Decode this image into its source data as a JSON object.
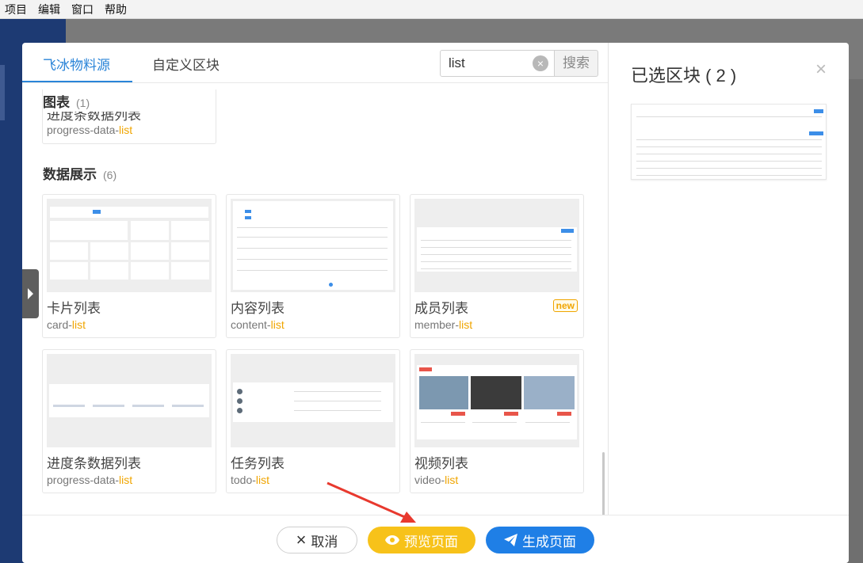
{
  "menubar": {
    "items": [
      "项目",
      "编辑",
      "窗口",
      "帮助"
    ]
  },
  "modal": {
    "tabs": [
      {
        "label": "飞冰物料源"
      },
      {
        "label": "自定义区块"
      }
    ],
    "search": {
      "value": "list",
      "clear_icon": "×",
      "button_label": "搜索"
    },
    "sections": [
      {
        "title": "图表",
        "count": "(1)"
      },
      {
        "title": "数据展示",
        "count": "(6)"
      }
    ],
    "partial_card": {
      "name": "进度条数据列表",
      "slug_prefix": "progress-data-",
      "slug_highlight": "list"
    },
    "cards": [
      {
        "name": "卡片列表",
        "slug_prefix": "card-",
        "slug_highlight": "list"
      },
      {
        "name": "内容列表",
        "slug_prefix": "content-",
        "slug_highlight": "list"
      },
      {
        "name": "成员列表",
        "slug_prefix": "member-",
        "slug_highlight": "list",
        "badge": "new"
      },
      {
        "name": "进度条数据列表",
        "slug_prefix": "progress-data-",
        "slug_highlight": "list"
      },
      {
        "name": "任务列表",
        "slug_prefix": "todo-",
        "slug_highlight": "list"
      },
      {
        "name": "视频列表",
        "slug_prefix": "video-",
        "slug_highlight": "list"
      }
    ],
    "selected": {
      "title": "已选区块 ( 2 )",
      "close_icon": "×"
    },
    "footer": {
      "cancel": {
        "icon": "×",
        "label": "取消"
      },
      "preview": {
        "label": "预览页面"
      },
      "generate": {
        "label": "生成页面"
      }
    }
  },
  "colors": {
    "primary": "#2a84d8",
    "highlight": "#f0a500",
    "preview_button": "#f7c21a",
    "generate_button": "#1f7fe6",
    "annotation_arrow": "#e8392e"
  }
}
